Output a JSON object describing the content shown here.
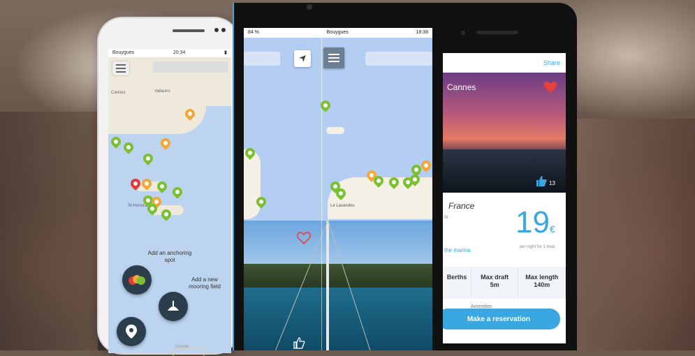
{
  "phone1": {
    "status": {
      "carrier": "Bouygues",
      "time": "20:34"
    },
    "map_places": [
      "Cannes",
      "Vallauris",
      "St-Honorat"
    ],
    "add_anchoring_label": "Add an anchoring spot",
    "add_mooring_label": "Add a new mooring field",
    "map_credit": "Google"
  },
  "phone2": {
    "status": {
      "left": "84 %",
      "carrier": "Bouygues",
      "time": "18:38"
    },
    "map_place": "Le Lavandou"
  },
  "phone3": {
    "share_label": "Share",
    "title": "Cannes",
    "likes": "13",
    "country": "France",
    "coords": "N",
    "price": "19",
    "currency": "€",
    "price_sub": "per night for 1 boat",
    "marina_link": "the marina",
    "specs": [
      {
        "label": "Berths",
        "value": ""
      },
      {
        "label": "Max draft",
        "value": "5m"
      },
      {
        "label": "Max length",
        "value": "140m"
      }
    ],
    "amenities_label": "Amenities",
    "reserve_button": "Make a reservation"
  },
  "colors": {
    "accent": "#3aa7e0",
    "pin_green": "#7cbf34",
    "pin_orange": "#f0a83a",
    "pin_red": "#e23a3a",
    "heart": "#e8403d"
  }
}
